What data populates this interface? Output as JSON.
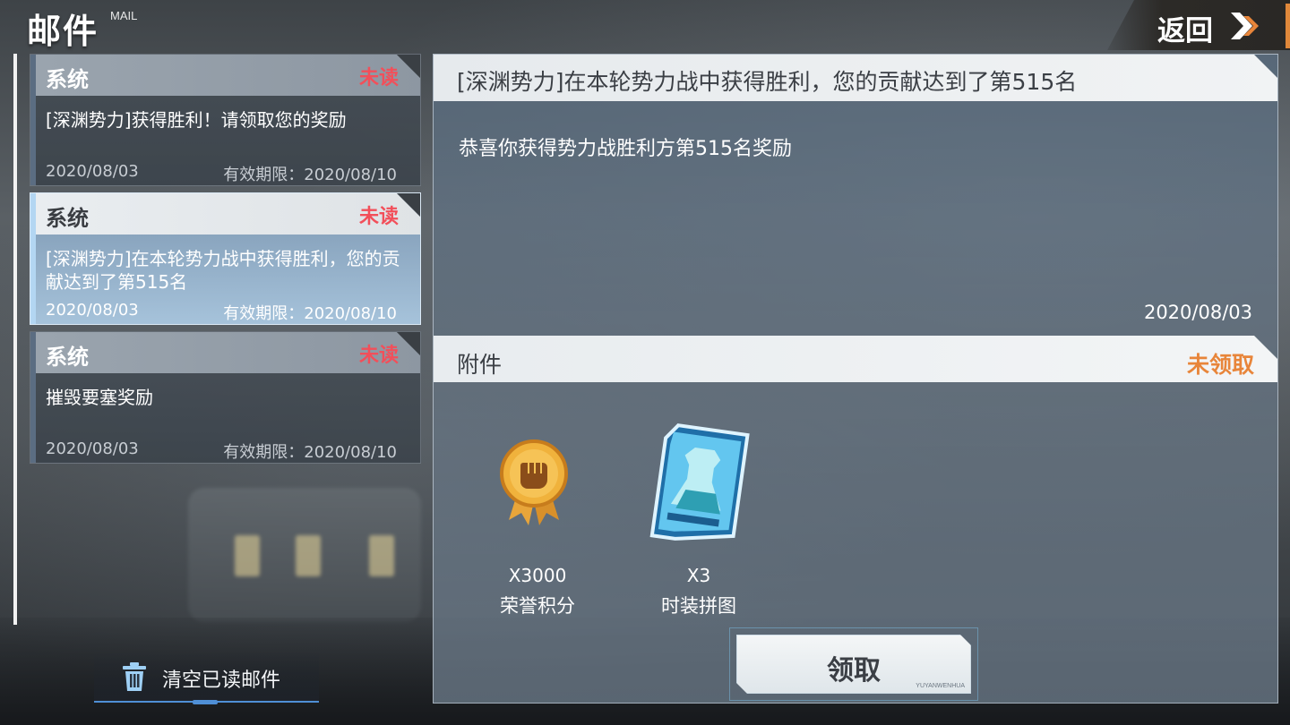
{
  "header": {
    "title": "邮件",
    "subtitle": "MAIL",
    "back_label": "返回"
  },
  "mail_list": [
    {
      "sender": "系统",
      "status": "未读",
      "subject": "[深渊势力]获得胜利！请领取您的奖励",
      "date": "2020/08/03",
      "expire": "有效期限：2020/08/10",
      "selected": false
    },
    {
      "sender": "系统",
      "status": "未读",
      "subject": "[深渊势力]在本轮势力战中获得胜利，您的贡献达到了第515名",
      "date": "2020/08/03",
      "expire": "有效期限：2020/08/10",
      "selected": true
    },
    {
      "sender": "系统",
      "status": "未读",
      "subject": "摧毁要塞奖励",
      "date": "2020/08/03",
      "expire": "有效期限：2020/08/10",
      "selected": false
    }
  ],
  "clear_button": {
    "label": "清空已读邮件"
  },
  "detail": {
    "title": "[深渊势力]在本轮势力战中获得胜利，您的贡献达到了第515名",
    "body": "恭喜你获得势力战胜利方第515名奖励",
    "date": "2020/08/03",
    "attachment_label": "附件",
    "attachment_status": "未领取",
    "rewards": [
      {
        "count": "X3000",
        "name": "荣誉积分",
        "icon": "honor-medal-icon"
      },
      {
        "count": "X3",
        "name": "时装拼图",
        "icon": "outfit-puzzle-card-icon"
      }
    ],
    "claim_label": "领取",
    "claim_tag": "YUYANWENHUA"
  },
  "colors": {
    "unread": "#f24f5a",
    "unclaimed": "#e8853a",
    "accent_blue": "#4f8fd6",
    "back_edge": "#e0883a"
  }
}
